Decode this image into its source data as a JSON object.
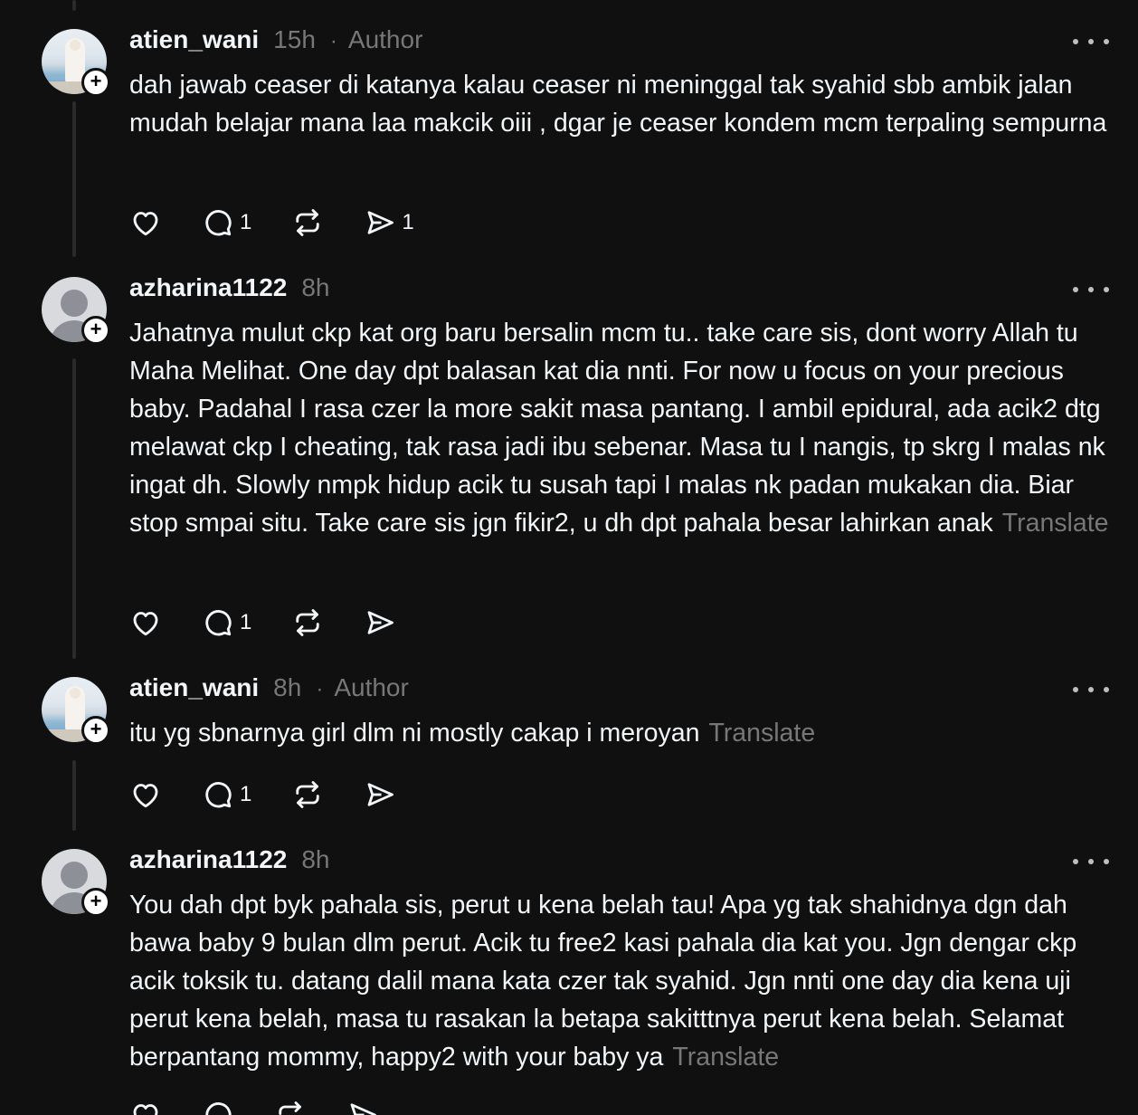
{
  "posts": [
    {
      "username": "atien_wani",
      "time": "15h",
      "separator": "·",
      "author_badge": "Author",
      "avatar": "photo",
      "text": "dah jawab ceaser di katanya kalau ceaser ni meninggal tak syahid sbb ambik jalan mudah belajar mana laa makcik oiii , dgar je ceaser kondem mcm terpaling sempurna",
      "translate": "",
      "reply_count": "1",
      "share_count": "1"
    },
    {
      "username": "azharina1122",
      "time": "8h",
      "avatar": "default",
      "text": "Jahatnya mulut ckp kat org baru bersalin mcm tu.. take care sis, dont worry Allah tu Maha Melihat. One day dpt balasan kat dia nnti. For now u focus on your precious baby. Padahal I rasa czer la more sakit masa pantang. I ambil epidural, ada acik2 dtg melawat ckp I cheating, tak rasa jadi ibu sebenar. Masa tu I nangis, tp skrg I malas nk ingat dh. Slowly nmpk hidup acik tu susah tapi I malas nk padan mukakan dia. Biar stop smpai situ. Take care sis jgn fikir2, u dh dpt pahala besar lahirkan anak",
      "translate": "Translate",
      "reply_count": "1"
    },
    {
      "username": "atien_wani",
      "time": "8h",
      "separator": "·",
      "author_badge": "Author",
      "avatar": "photo",
      "text": "itu yg sbnarnya girl dlm ni mostly cakap i meroyan",
      "translate": "Translate",
      "reply_count": "1"
    },
    {
      "username": "azharina1122",
      "time": "8h",
      "avatar": "default",
      "text": "You dah dpt byk pahala sis, perut u kena belah tau! Apa yg tak shahidnya dgn dah bawa baby 9 bulan dlm perut. Acik tu free2 kasi pahala dia kat you. Jgn dengar ckp acik toksik tu. datang dalil mana kata czer tak syahid. Jgn nnti one day dia kena uji perut kena belah, masa tu rasakan la betapa sakitttnya perut kena belah. Selamat berpantang mommy, happy2 with your baby ya",
      "translate": "Translate"
    }
  ],
  "icons": {
    "like": "heart-icon",
    "reply": "comment-icon",
    "repost": "repost-icon",
    "share": "send-icon",
    "more": "more-options-icon",
    "follow": "plus-icon"
  },
  "colors": {
    "background": "#101010",
    "text": "#f3f5f7",
    "muted": "#777777",
    "badge": "#ffffff"
  }
}
